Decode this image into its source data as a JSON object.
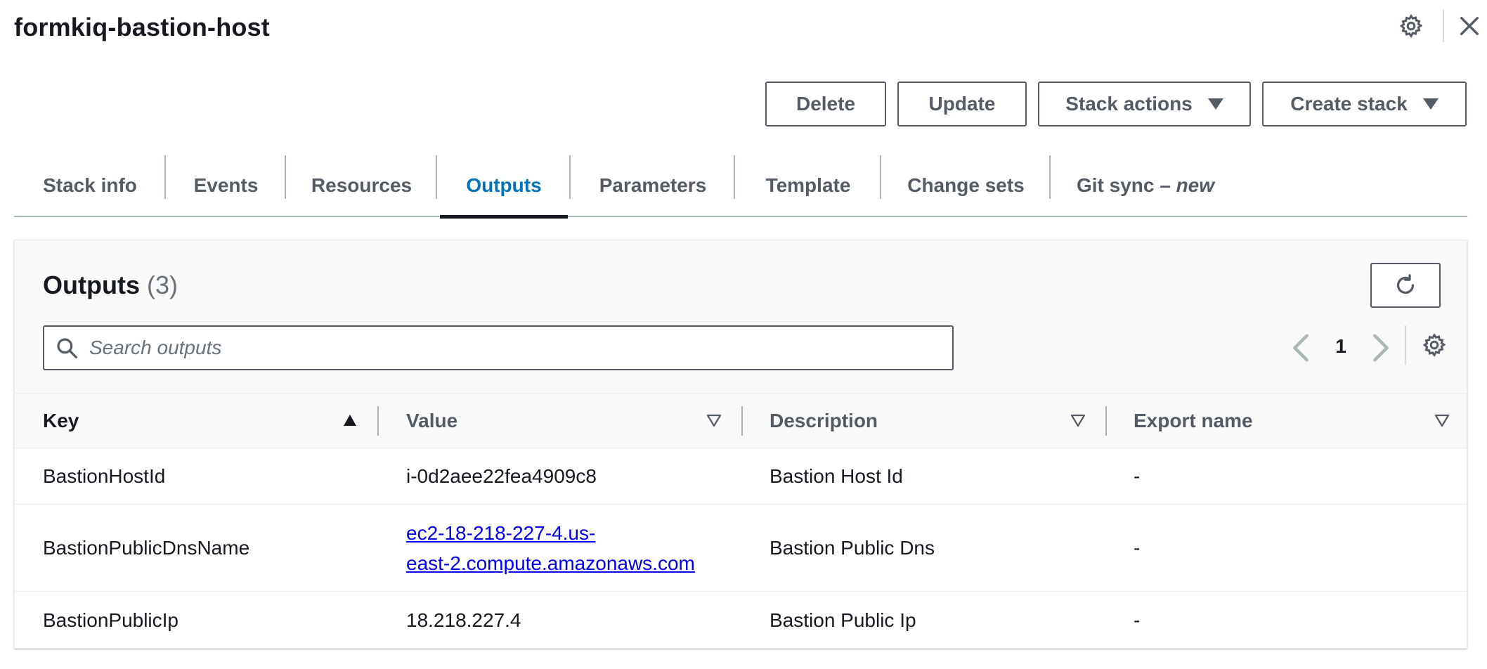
{
  "header": {
    "title": "formkiq-bastion-host"
  },
  "actions": {
    "delete_label": "Delete",
    "update_label": "Update",
    "stack_actions_label": "Stack actions",
    "create_stack_label": "Create stack"
  },
  "tabs": [
    {
      "label": "Stack info"
    },
    {
      "label": "Events"
    },
    {
      "label": "Resources"
    },
    {
      "label": "Outputs",
      "active": true
    },
    {
      "label": "Parameters"
    },
    {
      "label": "Template"
    },
    {
      "label": "Change sets"
    },
    {
      "label": "Git sync – ",
      "suffix": "new"
    }
  ],
  "outputs": {
    "title": "Outputs",
    "count": "(3)",
    "search_placeholder": "Search outputs",
    "page": "1",
    "columns": [
      "Key",
      "Value",
      "Description",
      "Export name"
    ],
    "sort_column": "Key",
    "rows": [
      {
        "key": "BastionHostId",
        "value": "i-0d2aee22fea4909c8",
        "value_is_link": false,
        "description": "Bastion Host Id",
        "export_name": "-"
      },
      {
        "key": "BastionPublicDnsName",
        "value_line1": "ec2-18-218-227-4.us-",
        "value_line2": "east-2.compute.amazonaws.com",
        "value_is_link": true,
        "description": "Bastion Public Dns",
        "export_name": "-"
      },
      {
        "key": "BastionPublicIp",
        "value": "18.218.227.4",
        "value_is_link": false,
        "description": "Bastion Public Ip",
        "export_name": "-"
      }
    ]
  },
  "colors": {
    "active_tab": "#0073bb",
    "link": "#0000ee",
    "text": "#16191f",
    "muted": "#545b64"
  },
  "icons": {
    "settings": "gear-icon",
    "close": "close-icon",
    "refresh": "refresh-icon",
    "search": "search-icon",
    "sort_asc": "sort-ascending-icon",
    "sort_none": "sort-descending-outline-icon"
  }
}
